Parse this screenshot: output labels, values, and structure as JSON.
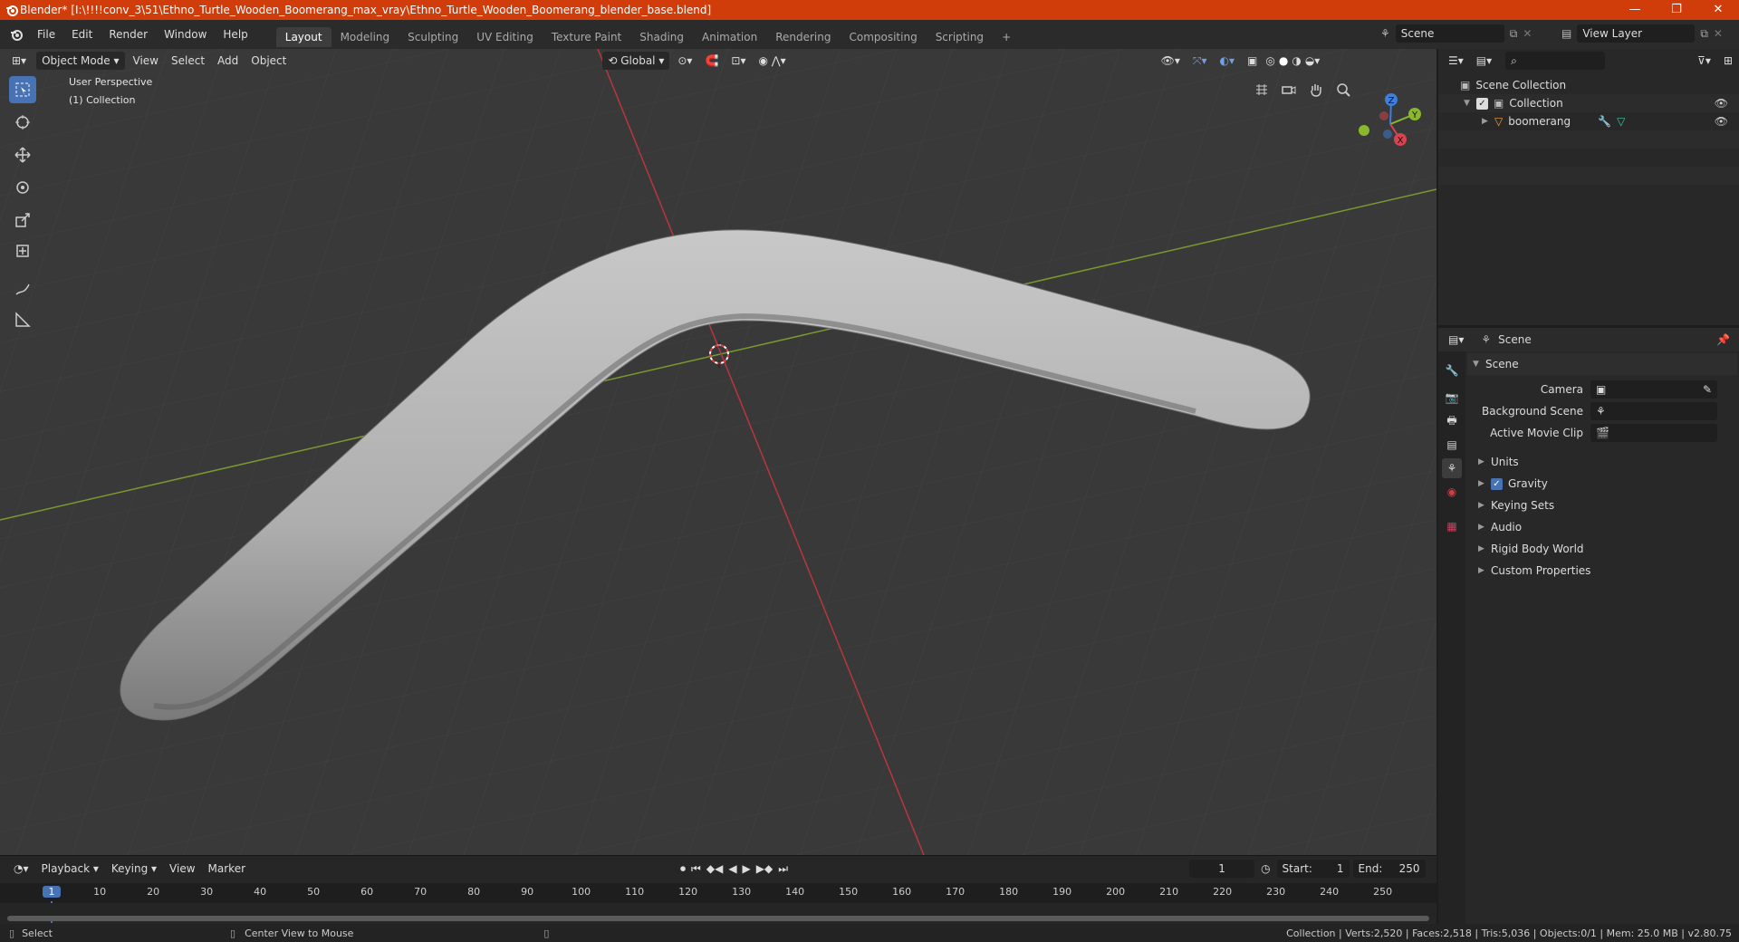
{
  "window": {
    "title": "Blender* [I:\\!!!!conv_3\\51\\Ethno_Turtle_Wooden_Boomerang_max_vray\\Ethno_Turtle_Wooden_Boomerang_blender_base.blend]",
    "minimize": "—",
    "maximize": "❐",
    "close": "✕"
  },
  "menu": {
    "items": [
      "File",
      "Edit",
      "Render",
      "Window",
      "Help"
    ]
  },
  "workspaces": [
    "Layout",
    "Modeling",
    "Sculpting",
    "UV Editing",
    "Texture Paint",
    "Shading",
    "Animation",
    "Rendering",
    "Compositing",
    "Scripting"
  ],
  "workspace_add": "+",
  "scene_selector": {
    "value": "Scene"
  },
  "view_layer_selector": {
    "value": "View Layer"
  },
  "viewport": {
    "mode": "Object Mode",
    "header_menus": [
      "View",
      "Select",
      "Add",
      "Object"
    ],
    "transform_orientation": "Global",
    "overlay_line1": "User Perspective",
    "overlay_line2": "(1) Collection",
    "gizmo": {
      "x": "X",
      "y": "Y",
      "z": "Z"
    }
  },
  "outliner": {
    "root": "Scene Collection",
    "collection": "Collection",
    "object": "boomerang"
  },
  "properties": {
    "context": "Scene",
    "panel_title": "Scene",
    "camera_label": "Camera",
    "background_label": "Background Scene",
    "movieclip_label": "Active Movie Clip",
    "sections": [
      "Units",
      "Gravity",
      "Keying Sets",
      "Audio",
      "Rigid Body World",
      "Custom Properties"
    ]
  },
  "timeline": {
    "menus": [
      "Playback",
      "Keying",
      "View",
      "Marker"
    ],
    "current_frame": "1",
    "start_label": "Start:",
    "start": "1",
    "end_label": "End:",
    "end": "250",
    "ticks": [
      "1",
      "10",
      "20",
      "30",
      "40",
      "50",
      "60",
      "70",
      "80",
      "90",
      "100",
      "110",
      "120",
      "130",
      "140",
      "150",
      "160",
      "170",
      "180",
      "190",
      "200",
      "210",
      "220",
      "230",
      "240",
      "250"
    ]
  },
  "statusbar": {
    "left": "Select",
    "middle": "Center View to Mouse",
    "right": "Collection | Verts:2,520 | Faces:2,518 | Tris:5,036 | Objects:0/1 | Mem: 25.0 MB | v2.80.75"
  },
  "colors": {
    "accent": "#4772b3",
    "titlebar": "#d03c0a",
    "x_axis": "#d9434f",
    "y_axis": "#8ab82c",
    "z_axis": "#3d7fde"
  }
}
